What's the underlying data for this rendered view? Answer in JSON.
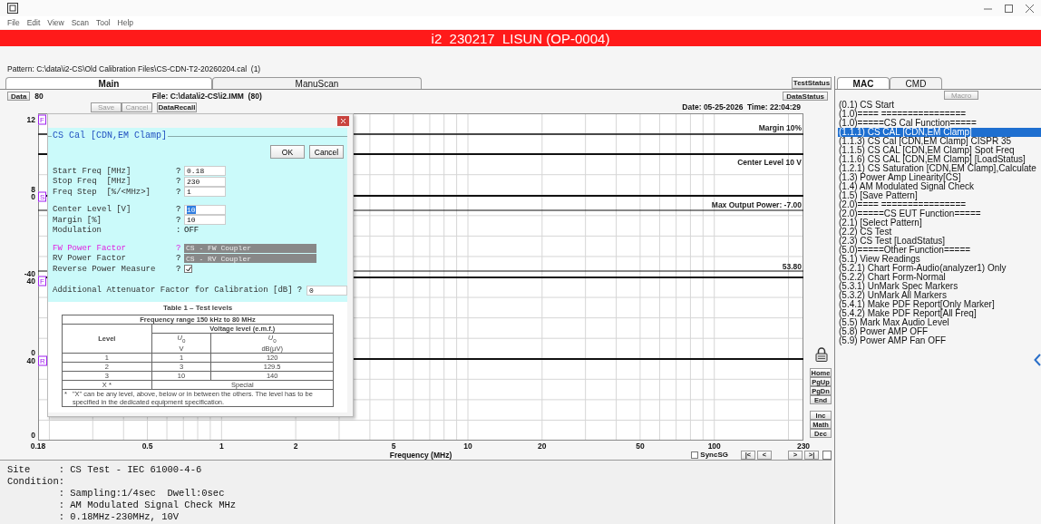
{
  "window": {
    "menu": [
      "File",
      "Edit",
      "View",
      "Scan",
      "Tool",
      "Help"
    ]
  },
  "banner": {
    "title": "i2  230217  LISUN (OP-0004)"
  },
  "pattern": "Pattern: C:\\data\\i2-CS\\Old Calibration Files\\CS-CDN-T2-20260204.cal  (1)",
  "main_tabs": [
    {
      "label": "Main",
      "selected": true
    },
    {
      "label": "ManuScan",
      "selected": false
    }
  ],
  "test_status_button": "TestStatus",
  "data_bar": {
    "data_button": "Data",
    "data_value": "80",
    "file": "File: C:\\data\\i2-CS\\i2.IMM  (80)",
    "data_status_button": "DataStatus"
  },
  "actions": [
    {
      "label": "Save",
      "disabled": true
    },
    {
      "label": "Cancel",
      "disabled": true
    },
    {
      "label": "DataRecall",
      "disabled": false
    }
  ],
  "timestamp": "Date: 05-25-2026  Time: 22:04:29",
  "chart": {
    "y_labels": [
      {
        "text": "12",
        "marker": "F"
      },
      {
        "text": "8"
      },
      {
        "text": "0",
        "marker": "S"
      },
      {
        "text": "-40"
      },
      {
        "text": "40",
        "marker": "F"
      },
      {
        "text": "0"
      },
      {
        "text": "40",
        "marker": "R"
      },
      {
        "text": "0"
      }
    ],
    "lines": [
      {
        "label": "Margin 10%"
      },
      {
        "label": "Center Level 10 V"
      },
      {
        "label": "Max Output Power: -7.00"
      },
      {
        "label": "53.80"
      }
    ],
    "x_ticks": [
      "0.18",
      "0.5",
      "1",
      "2",
      "5",
      "10",
      "20",
      "50",
      "100",
      "230"
    ],
    "xlabel": "Frequency (MHz)"
  },
  "side_buttons": [
    [
      "Home",
      "PgUp",
      "PgDn",
      "End"
    ],
    [
      "Inc",
      "Math",
      "Dec"
    ]
  ],
  "sync": {
    "label": "SyncSG",
    "checked": false
  },
  "extra_checkbox": {
    "checked": false
  },
  "nav_buttons": [
    "|<",
    "<",
    ">",
    ">|"
  ],
  "dialog": {
    "group_title": "CS Cal [CDN,EM Clamp]",
    "ok_button": "OK",
    "cancel_button": "Cancel",
    "field_groups": [
      [
        {
          "kind": "input",
          "label": "Start Freq [MHz]",
          "prompt": "?",
          "value": "0.18",
          "focused": false,
          "value_selected": false
        },
        {
          "kind": "input",
          "label": "Stop Freq  [MHz]",
          "prompt": "?",
          "value": "230",
          "focused": false,
          "value_selected": false
        },
        {
          "kind": "input",
          "label": "Freq Step  [%/<MHz>]",
          "prompt": "?",
          "value": "1",
          "focused": false,
          "value_selected": false
        }
      ],
      [
        {
          "kind": "input",
          "label": "Center Level [V]",
          "prompt": "?",
          "value": "10",
          "focused": false,
          "value_selected": true
        },
        {
          "kind": "input",
          "label": "Margin [%]",
          "prompt": "?",
          "value": "10",
          "focused": false,
          "value_selected": false
        },
        {
          "kind": "text",
          "label": "Modulation",
          "prompt": ":",
          "value": "OFF",
          "focused": false
        }
      ],
      [
        {
          "kind": "dropdown",
          "label": "FW Power Factor",
          "prompt": "?",
          "value": "CS - FW Coupler",
          "focused": true
        },
        {
          "kind": "dropdown",
          "label": "RV Power Factor",
          "prompt": "?",
          "value": "CS - RV Coupler",
          "focused": false
        },
        {
          "kind": "checkbox",
          "label": "Reverse Power Measure",
          "prompt": "?",
          "checked": true,
          "focused": false
        }
      ],
      [
        {
          "kind": "inline_input",
          "label": "Additional Attenuator Factor for Calibration [dB]",
          "prompt": "?",
          "value": "0",
          "focused": false,
          "value_selected": false
        }
      ]
    ],
    "document": {
      "caption": "Table 1 – Test levels",
      "range_header": "Frequency range 150 kHz to 80 MHz",
      "voltage_header": "Voltage level (e.m.f.)",
      "columns": [
        {
          "kind": "label",
          "label": "Level"
        },
        {
          "kind": "symbol",
          "symbol": "*U*$_{0}$",
          "unit": "V"
        },
        {
          "kind": "symbol",
          "symbol": "*U*$_{0}$",
          "unit": "dB(µV)"
        }
      ],
      "rows": [
        [
          "1",
          "1",
          "120"
        ],
        [
          "2",
          "3",
          "129.5"
        ],
        [
          "3",
          "10",
          "140"
        ]
      ],
      "special_row": [
        "X *",
        "Special"
      ],
      "footnote_mark": "*",
      "footnote": "\"X\" can be any level, above, below or in between the others. The level has to be specified in the dedicated equipment specification."
    }
  },
  "info": [
    "Site     : CS Test - IEC 61000-4-6",
    "Condition:",
    "         : Sampling:1/4sec  Dwell:0sec",
    "         : AM Modulated Signal Check MHz",
    "         : 0.18MHz-230MHz, 10V"
  ],
  "macro_panel": {
    "tabs": [
      {
        "label": "MAC",
        "selected": true
      },
      {
        "label": "CMD",
        "selected": false
      }
    ],
    "macro_button": "Macro",
    "items": [
      {
        "label": "(0.1) CS Start",
        "selected": false
      },
      {
        "label": "(1.0)==== ================",
        "selected": false
      },
      {
        "label": "(1.0)=====CS Cal Function=====",
        "selected": false
      },
      {
        "label": "(1.1.1) CS CAL [CDN,EM Clamp]",
        "selected": true
      },
      {
        "label": "(1.1.3) CS Cal [CDN,EM Clamp] CISPR 35",
        "selected": false
      },
      {
        "label": "(1.1.5) CS CAL [CDN,EM Clamp] Spot Freq",
        "selected": false
      },
      {
        "label": "(1.1.6) CS CAL [CDN,EM Clamp] [LoadStatus]",
        "selected": false
      },
      {
        "label": "(1.2.1) CS Saturation [CDN,EM Clamp],Calculate",
        "selected": false
      },
      {
        "label": "(1.3) Power Amp Linearity[CS]",
        "selected": false
      },
      {
        "label": "(1.4) AM Modulated Signal Check",
        "selected": false
      },
      {
        "label": "(1.5) [Save Pattern]",
        "selected": false
      },
      {
        "label": "(2.0)==== ================",
        "selected": false
      },
      {
        "label": "(2.0)=====CS EUT Function=====",
        "selected": false
      },
      {
        "label": "(2.1) [Select Pattern]",
        "selected": false
      },
      {
        "label": "(2.2) CS Test",
        "selected": false
      },
      {
        "label": "(2.3) CS Test [LoadStatus]",
        "selected": false
      },
      {
        "label": "(5.0)=====Other Function=====",
        "selected": false
      },
      {
        "label": "(5.1) View Readings",
        "selected": false
      },
      {
        "label": "(5.2.1) Chart Form-Audio(analyzer1) Only",
        "selected": false
      },
      {
        "label": "(5.2.2) Chart Form-Normal",
        "selected": false
      },
      {
        "label": "(5.3.1) UnMark Spec Markers",
        "selected": false
      },
      {
        "label": "(5.3.2) UnMark All Markers",
        "selected": false
      },
      {
        "label": "(5.4.1) Make PDF Report[Only Marker]",
        "selected": false
      },
      {
        "label": "(5.4.2) Make PDF Report[All Freq]",
        "selected": false
      },
      {
        "label": "(5.5) Mark Max Audio Level",
        "selected": false
      },
      {
        "label": "(5.8) Power AMP OFF",
        "selected": false
      },
      {
        "label": "(5.9) Power AMP Fan OFF",
        "selected": false
      }
    ]
  }
}
